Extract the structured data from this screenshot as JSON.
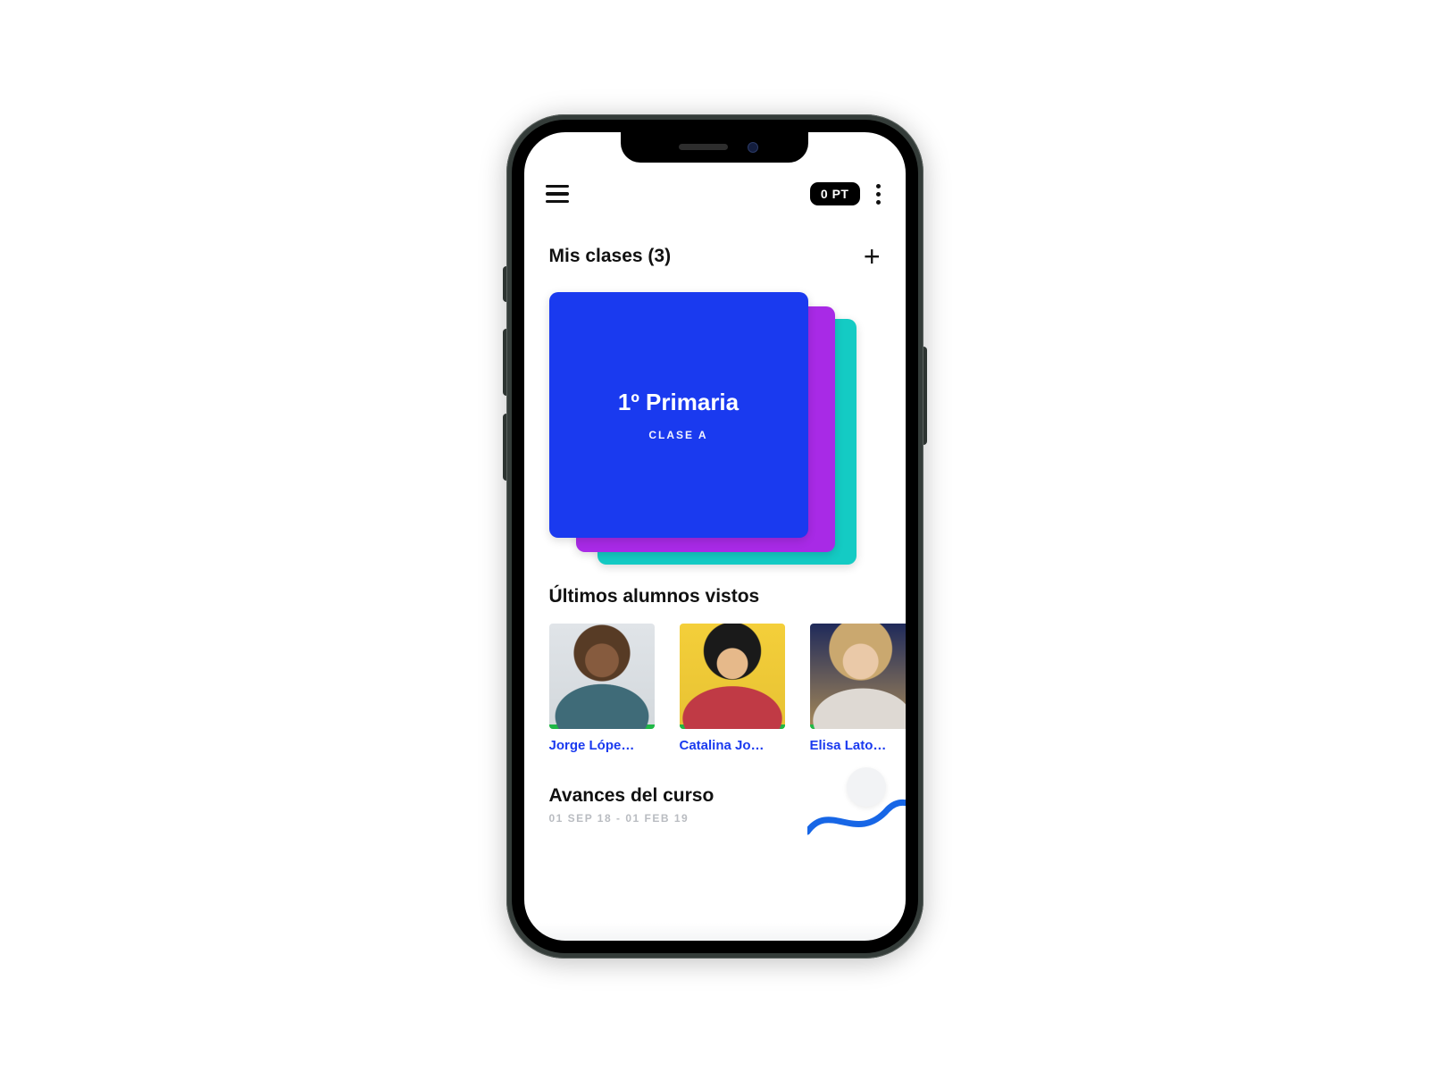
{
  "header": {
    "points_chip": "0 PT"
  },
  "classes_section": {
    "title": "Mis clases (3)",
    "cards": {
      "front": {
        "grade": "1º Primaria",
        "group": "CLASE A",
        "color": "#1a3aef"
      },
      "middle": {
        "color": "#a82ae6"
      },
      "back": {
        "color": "#14cbc4"
      }
    }
  },
  "students_section": {
    "title": "Últimos alumnos vistos",
    "students": [
      {
        "name": "Jorge Lópe…"
      },
      {
        "name": "Catalina Jo…"
      },
      {
        "name": "Elisa Lato…"
      }
    ]
  },
  "progress_section": {
    "title": "Avances del curso",
    "date_range": "01 SEP 18 - 01 FEB 19"
  }
}
